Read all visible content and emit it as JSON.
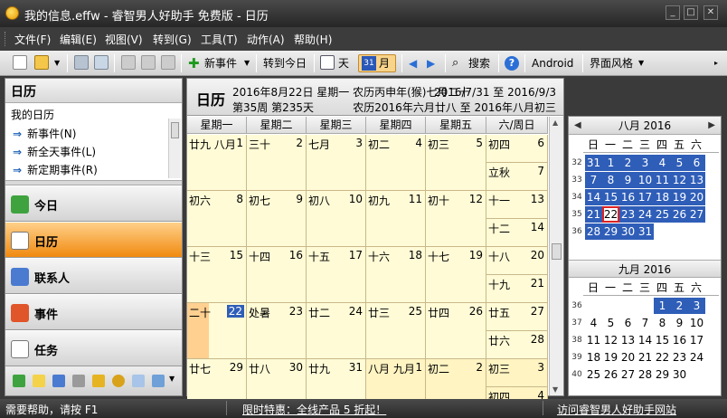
{
  "window": {
    "title": "我的信息.effw - 睿智男人好助手 免费版 - 日历"
  },
  "menu": [
    "文件(F)",
    "编辑(E)",
    "视图(V)",
    "转到(G)",
    "工具(T)",
    "动作(A)",
    "帮助(H)"
  ],
  "toolbar": {
    "new_event": "新事件",
    "goto_today": "转到今日",
    "day": "天",
    "month": "月",
    "month_icon_num": "31",
    "search": "搜索",
    "android": "Android",
    "skin": "界面风格"
  },
  "left": {
    "header": "日历",
    "my_calendar": "我的日历",
    "tasks": [
      "新事件(N)",
      "新全天事件(L)",
      "新定期事件(R)"
    ],
    "nav": [
      "今日",
      "日历",
      "联系人",
      "事件",
      "任务"
    ]
  },
  "main": {
    "view_title": "日历",
    "date_line": "2016年8月22日 星期一 农历丙申年(猴)七月二十",
    "week_line": "第35周 第235天",
    "range": "2016/7/31 至 2016/9/3",
    "lunar_range": "农历2016年六月廿八 至 2016年八月初三",
    "columns": [
      "星期一",
      "星期二",
      "星期三",
      "星期四",
      "星期五",
      "六/周日"
    ],
    "weeks": [
      {
        "days": [
          [
            "廿九 八月",
            "1"
          ],
          [
            "三十",
            "2"
          ],
          [
            "七月",
            "3"
          ],
          [
            "初二",
            "4"
          ],
          [
            "初三",
            "5"
          ]
        ],
        "weekend": [
          [
            "初四",
            "6"
          ],
          [
            "立秋",
            "7"
          ]
        ]
      },
      {
        "days": [
          [
            "初六",
            "8"
          ],
          [
            "初七",
            "9"
          ],
          [
            "初八",
            "10"
          ],
          [
            "初九",
            "11"
          ],
          [
            "初十",
            "12"
          ]
        ],
        "weekend": [
          [
            "十一",
            "13"
          ],
          [
            "十二",
            "14"
          ]
        ]
      },
      {
        "days": [
          [
            "十三",
            "15"
          ],
          [
            "十四",
            "16"
          ],
          [
            "十五",
            "17"
          ],
          [
            "十六",
            "18"
          ],
          [
            "十七",
            "19"
          ]
        ],
        "weekend": [
          [
            "十八",
            "20"
          ],
          [
            "十九",
            "21"
          ]
        ]
      },
      {
        "days": [
          [
            "二十",
            "22"
          ],
          [
            "处暑",
            "23"
          ],
          [
            "廿二",
            "24"
          ],
          [
            "廿三",
            "25"
          ],
          [
            "廿四",
            "26"
          ]
        ],
        "weekend": [
          [
            "廿五",
            "27"
          ],
          [
            "廿六",
            "28"
          ]
        ]
      },
      {
        "days": [
          [
            "廿七",
            "29"
          ],
          [
            "廿八",
            "30"
          ],
          [
            "廿九",
            "31"
          ],
          [
            "八月 九月",
            "1"
          ],
          [
            "初二",
            "2"
          ]
        ],
        "weekend": [
          [
            "初三",
            "3"
          ],
          [
            "初四",
            "4"
          ]
        ]
      }
    ]
  },
  "mini_calendars": [
    {
      "title": "八月 2016",
      "dow": [
        "日",
        "一",
        "二",
        "三",
        "四",
        "五",
        "六"
      ],
      "weeks": [
        {
          "wk": "32",
          "days": [
            "31",
            "1",
            "2",
            "3",
            "4",
            "5",
            "6"
          ]
        },
        {
          "wk": "33",
          "days": [
            "7",
            "8",
            "9",
            "10",
            "11",
            "12",
            "13"
          ]
        },
        {
          "wk": "34",
          "days": [
            "14",
            "15",
            "16",
            "17",
            "18",
            "19",
            "20"
          ]
        },
        {
          "wk": "35",
          "days": [
            "21",
            "22",
            "23",
            "24",
            "25",
            "26",
            "27"
          ]
        },
        {
          "wk": "36",
          "days": [
            "28",
            "29",
            "30",
            "31",
            "",
            "",
            ""
          ]
        }
      ]
    },
    {
      "title": "九月 2016",
      "dow": [
        "日",
        "一",
        "二",
        "三",
        "四",
        "五",
        "六"
      ],
      "weeks": [
        {
          "wk": "36",
          "days": [
            "",
            "",
            "",
            "",
            "1",
            "2",
            "3"
          ]
        },
        {
          "wk": "37",
          "days": [
            "4",
            "5",
            "6",
            "7",
            "8",
            "9",
            "10"
          ]
        },
        {
          "wk": "38",
          "days": [
            "11",
            "12",
            "13",
            "14",
            "15",
            "16",
            "17"
          ]
        },
        {
          "wk": "39",
          "days": [
            "18",
            "19",
            "20",
            "21",
            "22",
            "23",
            "24"
          ]
        },
        {
          "wk": "40",
          "days": [
            "25",
            "26",
            "27",
            "28",
            "29",
            "30",
            ""
          ]
        }
      ]
    }
  ],
  "status": {
    "help": "需要帮助，请按 F1",
    "promo": "限时特惠：全线产品 5 折起！",
    "visit": "访问睿智男人好助手网站"
  },
  "colors": {
    "accent_selected": "#2f5eb8",
    "active_nav": "#f08a10",
    "cell_bg": "#fffbd6"
  }
}
